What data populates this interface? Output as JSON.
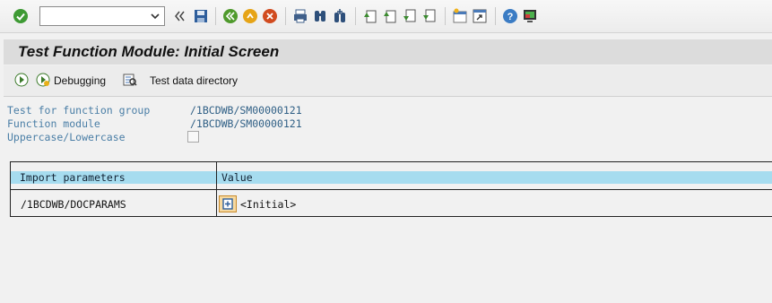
{
  "command_field": {
    "value": "",
    "placeholder": ""
  },
  "toolbar_icons": [
    "enter-icon",
    "back-nav-icon",
    "save-icon",
    "back-icon",
    "exit-icon",
    "cancel-icon",
    "print-icon",
    "find-icon",
    "find-next-icon",
    "first-page-icon",
    "previous-page-icon",
    "next-page-icon",
    "last-page-icon",
    "new-session-icon",
    "shortcut-icon",
    "help-icon",
    "customize-layout-icon"
  ],
  "title": "Test Function Module: Initial Screen",
  "app_toolbar": {
    "debugging": "Debugging",
    "test_data_directory": "Test data directory"
  },
  "fields": [
    {
      "label": "Test for function group",
      "value": "/1BCDWB/SM00000121"
    },
    {
      "label": "Function module",
      "value": "/1BCDWB/SM00000121"
    },
    {
      "label": "Uppercase/Lowercase",
      "checked": false
    }
  ],
  "table": {
    "headers": [
      "Import parameters",
      "Value"
    ],
    "rows": [
      {
        "param": "/1BCDWB/DOCPARAMS",
        "value": "<Initial>"
      }
    ]
  },
  "colors": {
    "header_highlight": "#a6dcef",
    "label_blue": "#4a7ea6",
    "value_blue": "#2f5f85"
  }
}
